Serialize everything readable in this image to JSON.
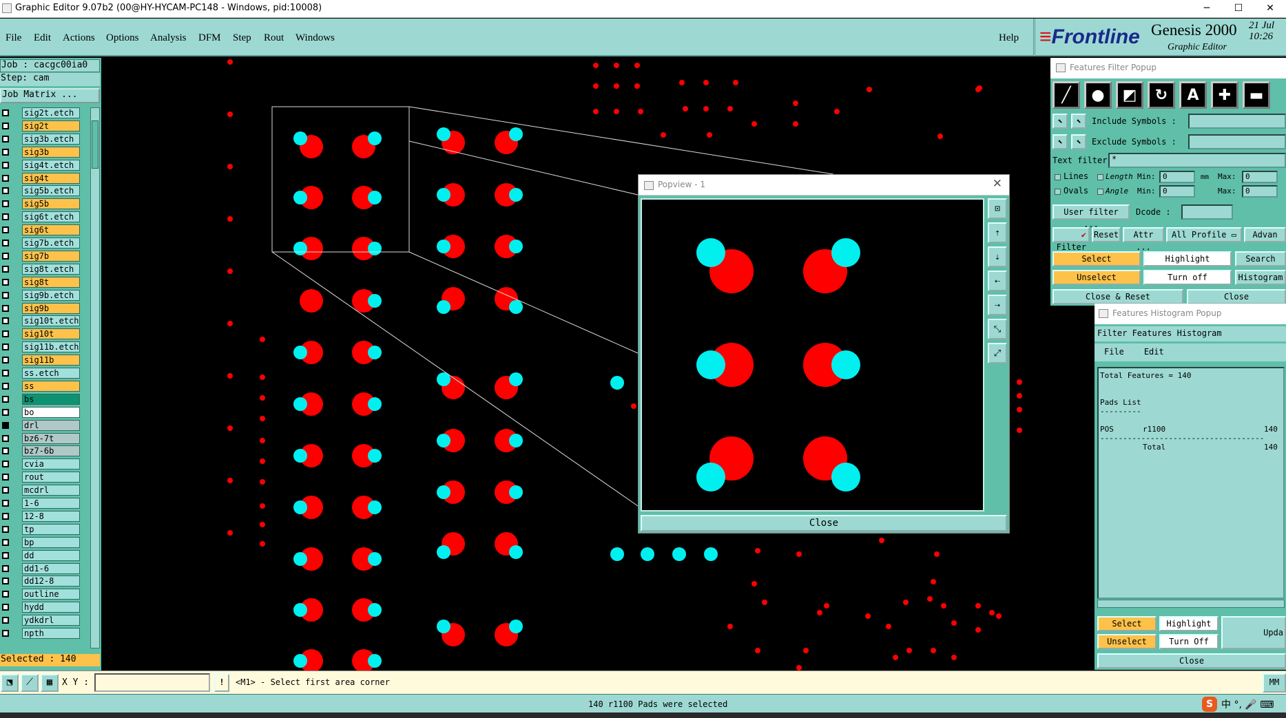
{
  "window": {
    "title": "Graphic Editor 9.07b2 (00@HY-HYCAM-PC148 - Windows, pid:10008)",
    "minimize": "─",
    "maximize": "☐",
    "close": "✕"
  },
  "menu": {
    "items": [
      "File",
      "Edit",
      "Actions",
      "Options",
      "Analysis",
      "DFM",
      "Step",
      "Rout",
      "Windows"
    ],
    "help": "Help"
  },
  "brand": {
    "logo_main": "Frontline",
    "logo_prefix": "≡",
    "product": "Genesis 2000",
    "subtitle": "Graphic Editor",
    "date_line1": "21 Jul",
    "date_line2": "10:26"
  },
  "left_panel": {
    "job": "Job : cacgc00ia0",
    "step": "Step: cam",
    "job_matrix": "Job Matrix ...",
    "layers": [
      {
        "name": "sig2t.etch",
        "color": "teal"
      },
      {
        "name": "sig2t",
        "color": "orange"
      },
      {
        "name": "sig3b.etch",
        "color": "teal"
      },
      {
        "name": "sig3b",
        "color": "orange"
      },
      {
        "name": "sig4t.etch",
        "color": "teal"
      },
      {
        "name": "sig4t",
        "color": "orange"
      },
      {
        "name": "sig5b.etch",
        "color": "teal"
      },
      {
        "name": "sig5b",
        "color": "orange"
      },
      {
        "name": "sig6t.etch",
        "color": "teal"
      },
      {
        "name": "sig6t",
        "color": "orange"
      },
      {
        "name": "sig7b.etch",
        "color": "teal"
      },
      {
        "name": "sig7b",
        "color": "orange"
      },
      {
        "name": "sig8t.etch",
        "color": "teal"
      },
      {
        "name": "sig8t",
        "color": "orange"
      },
      {
        "name": "sig9b.etch",
        "color": "teal"
      },
      {
        "name": "sig9b",
        "color": "orange"
      },
      {
        "name": "sig10t.etch",
        "color": "teal"
      },
      {
        "name": "sig10t",
        "color": "orange"
      },
      {
        "name": "sig11b.etch",
        "color": "teal"
      },
      {
        "name": "sig11b",
        "color": "orange"
      },
      {
        "name": "ss.etch",
        "color": "teal"
      },
      {
        "name": "ss",
        "color": "orange"
      },
      {
        "name": "bs",
        "color": "green"
      },
      {
        "name": "bo",
        "color": "white"
      },
      {
        "name": "drl",
        "color": "grey"
      },
      {
        "name": "bz6-7t",
        "color": "grey"
      },
      {
        "name": "bz7-6b",
        "color": "grey"
      },
      {
        "name": "cvia",
        "color": "teal"
      },
      {
        "name": "rout",
        "color": "teal"
      },
      {
        "name": "mcdrl",
        "color": "teal"
      },
      {
        "name": "1-6",
        "color": "teal"
      },
      {
        "name": "12-8",
        "color": "teal"
      },
      {
        "name": "tp",
        "color": "teal"
      },
      {
        "name": "bp",
        "color": "teal"
      },
      {
        "name": "dd",
        "color": "teal"
      },
      {
        "name": "dd1-6",
        "color": "teal"
      },
      {
        "name": "dd12-8",
        "color": "teal"
      },
      {
        "name": "outline",
        "color": "teal"
      },
      {
        "name": "hydd",
        "color": "teal"
      },
      {
        "name": "ydkdrl",
        "color": "teal"
      },
      {
        "name": "npth",
        "color": "teal"
      }
    ],
    "selected": "Selected : 140"
  },
  "popview": {
    "title": "Popview - 1",
    "close_x": "✕",
    "close_button": "Close",
    "tools": [
      "zoom-fit-icon",
      "pan-up-icon",
      "pan-down-icon",
      "pan-left-icon",
      "pan-right-icon",
      "zoom-in-icon",
      "zoom-out-icon"
    ]
  },
  "features_filter": {
    "title": "Features Filter Popup",
    "include_symbols": "Include Symbols :",
    "exclude_symbols": "Exclude Symbols :",
    "text_filter": "Text filter",
    "text_filter_value": "*",
    "lines": "Lines",
    "ovals": "Ovals",
    "length": "Length",
    "angle": "Angle",
    "min": "Min:",
    "max": "Max:",
    "unit": "mm",
    "min_val": "0",
    "max_val": "0",
    "user_filter": "User filter ...",
    "dcode": "Dcode :",
    "filter": "Filter",
    "reset": "Reset",
    "attr": "Attr ...",
    "all_profile": "All Profile",
    "advanced": "Advan",
    "select": "Select",
    "highlight": "Highlight",
    "search": "Search",
    "unselect": "Unselect",
    "turn_off": "Turn off",
    "histogram": "Histogram",
    "close_reset": "Close & Reset",
    "close": "Close"
  },
  "histogram": {
    "title": "Features Histogram Popup",
    "header": "Filter Features Histogram",
    "menu_file": "File",
    "menu_edit": "Edit",
    "total_features": "Total Features = 140",
    "pads_list": "Pads List",
    "pads_underline": "---------",
    "row_type": "POS",
    "row_symbol": "r1100",
    "row_count": "140",
    "divider": "------------------------------------",
    "total_label": "Total",
    "total_count": "140",
    "select": "Select",
    "highlight": "Highlight",
    "update": "Upda",
    "unselect": "Unselect",
    "turn_off": "Turn Off",
    "close": "Close"
  },
  "bottom": {
    "xy_label": "X Y :",
    "xy_value": "",
    "message": "<M1> - Select first area corner",
    "units": "MM",
    "status": "140 r1100 Pads were selected",
    "tray": "中 °, 🎤 ⌨"
  },
  "colors": {
    "panel": "#9dd9d2",
    "panel_dark": "#5fbfa8",
    "pad_red": "#ff0000",
    "pad_cyan": "#00f0f0",
    "highlight_orange": "#fec24a"
  }
}
